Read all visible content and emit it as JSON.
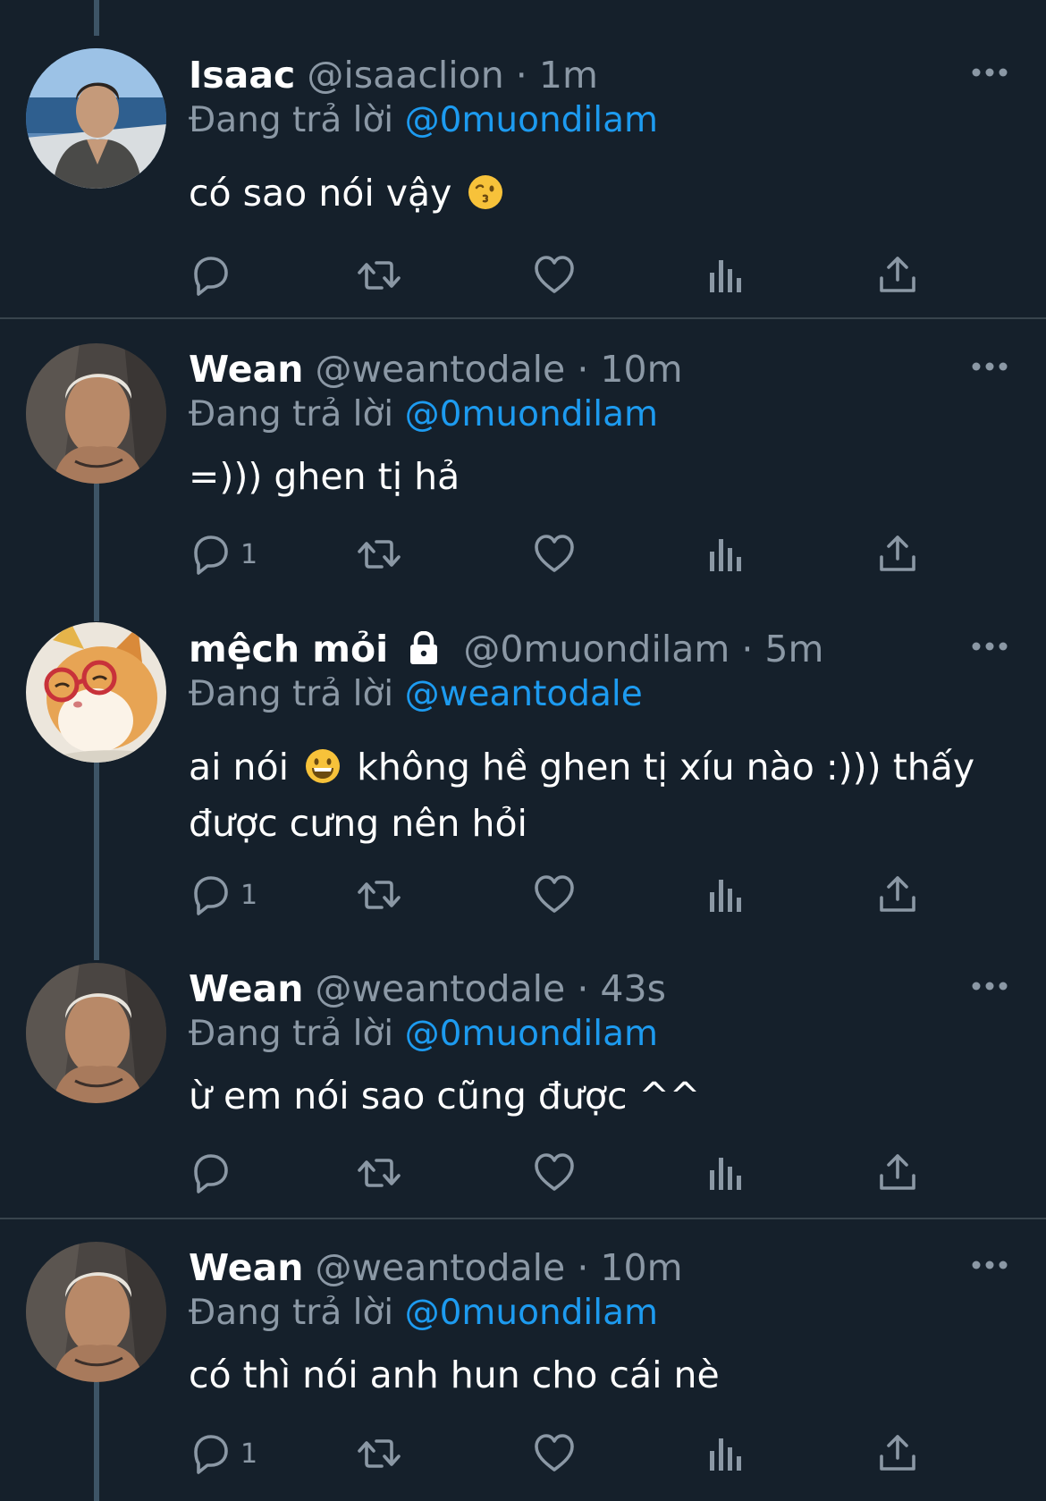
{
  "colors": {
    "background": "#15202b",
    "separator": "#38444d",
    "muted_text": "#8b98a5",
    "mention": "#1d9bf0",
    "primary_text": "#ffffff"
  },
  "replying_prefix": "Đang trả lời",
  "tweets": [
    {
      "name": "Isaac",
      "handle": "@isaaclion",
      "time": "· 1m",
      "locked": false,
      "reply_to": "@0muondilam",
      "text_parts": [
        "có sao nói vậy"
      ],
      "emoji": "kissing-face-icon",
      "reply_count": ""
    },
    {
      "name": "Wean",
      "handle": "@weantodale",
      "time": "· 10m",
      "locked": false,
      "reply_to": "@0muondilam",
      "text_parts": [
        "=))) ghen tị hả"
      ],
      "reply_count": "1"
    },
    {
      "name": "mệch mỏi",
      "handle": "@0muondilam",
      "time": "· 5m",
      "locked": true,
      "reply_to": "@weantodale",
      "text_parts": [
        "ai nói",
        "không hề ghen tị xíu nào :))) thấy",
        "được cưng nên hỏi"
      ],
      "emoji": "grinning-face-icon",
      "reply_count": "1"
    },
    {
      "name": "Wean",
      "handle": "@weantodale",
      "time": "· 43s",
      "locked": false,
      "reply_to": "@0muondilam",
      "text_parts": [
        "ừ em nói sao cũng được ^^"
      ],
      "reply_count": ""
    },
    {
      "name": "Wean",
      "handle": "@weantodale",
      "time": "· 10m",
      "locked": false,
      "reply_to": "@0muondilam",
      "text_parts": [
        "có thì nói anh hun cho cái nè"
      ],
      "reply_count": "1"
    }
  ]
}
